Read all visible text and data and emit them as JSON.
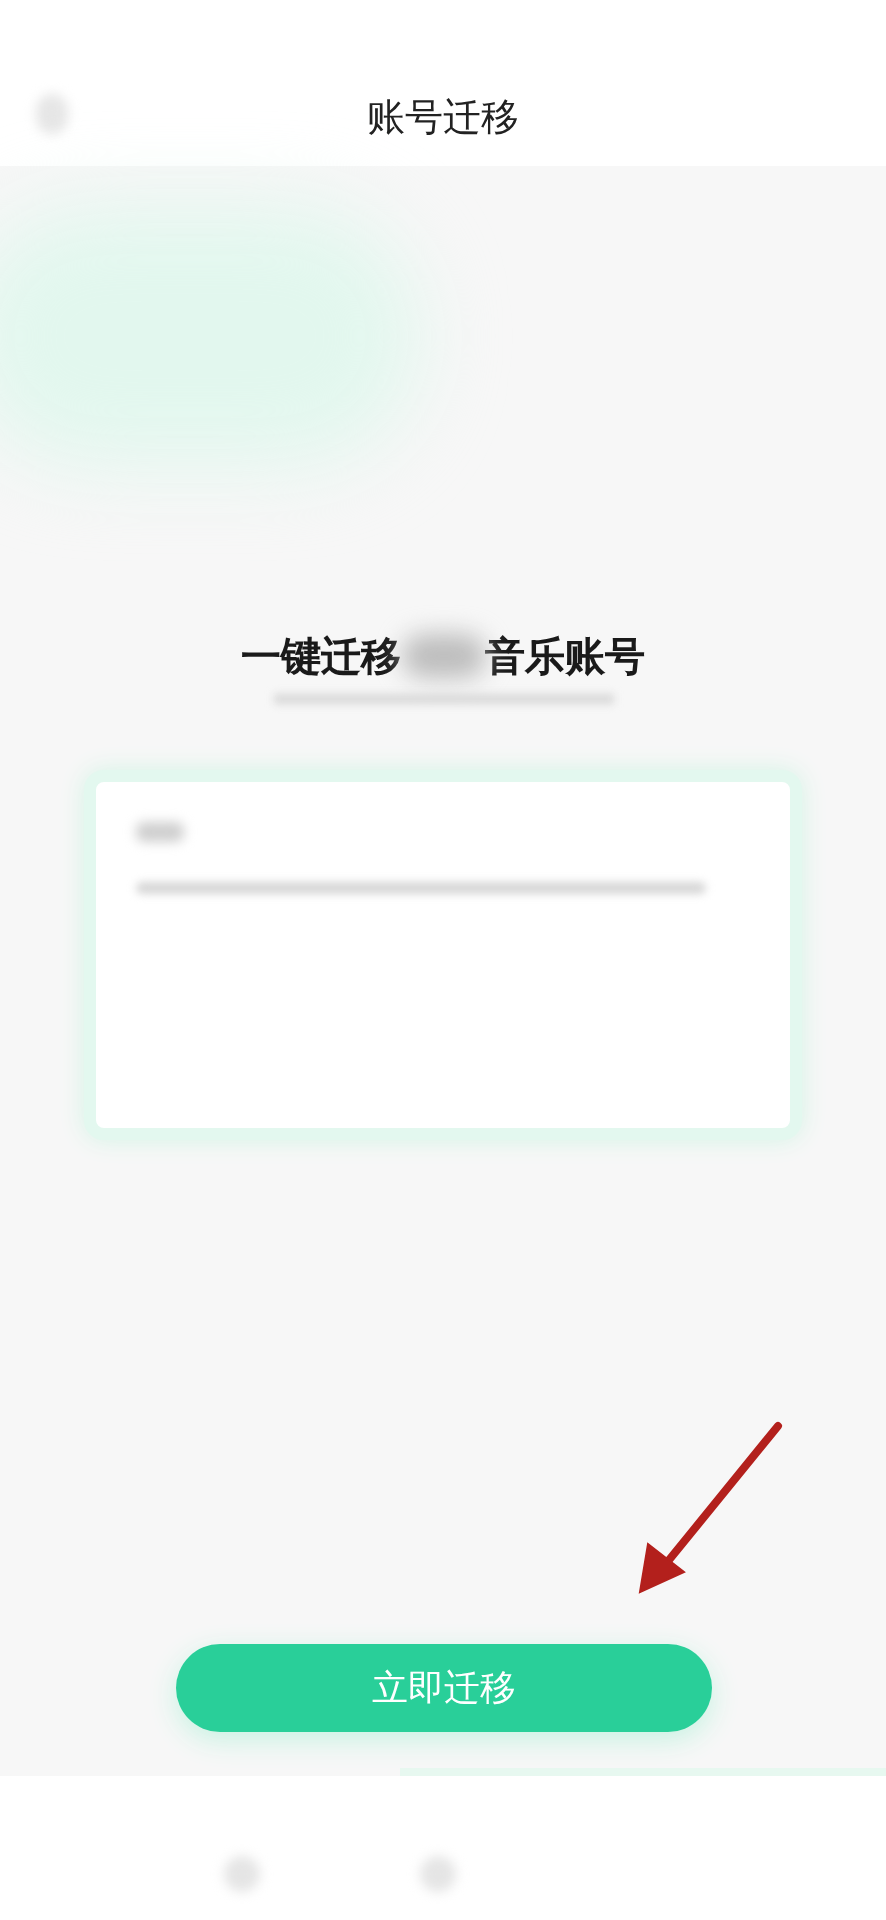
{
  "header": {
    "title": "账号迁移"
  },
  "headline": {
    "before": "一键迁移",
    "after": "音乐账号"
  },
  "action_button": {
    "label": "立即迁移"
  }
}
